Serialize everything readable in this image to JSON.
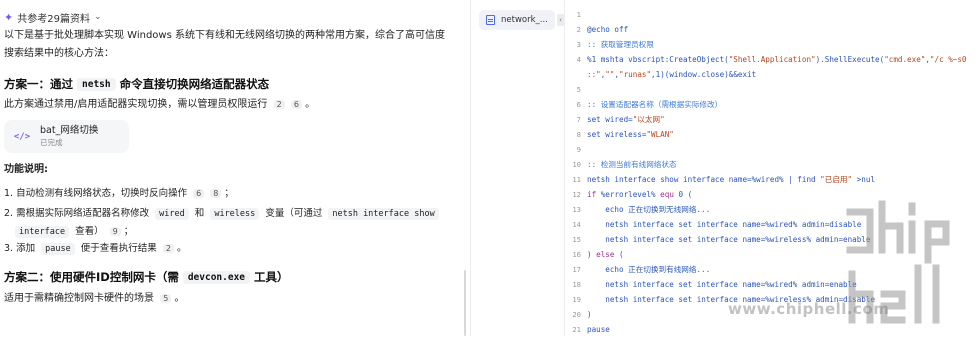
{
  "chat": {
    "sources_label": "共参考29篇资料",
    "intro_line1": "以下是基于批处理脚本实现 Windows 系统下有线和无线网络切换的两种常用方案，综合了高可信度",
    "intro_line2": "搜索结果中的核心方法：",
    "method1": {
      "title_prefix": "方案一：通过",
      "code": "netsh",
      "title_suffix": "命令直接切换网络适配器状态",
      "desc": "此方案通过禁用/启用适配器实现切换，需以管理员权限运行",
      "refs": [
        "2",
        "6"
      ]
    },
    "card": {
      "title": "bat_网络切换",
      "status": "已完成",
      "icon": "</>"
    },
    "features_title": "功能说明:",
    "features": [
      {
        "num": "1.",
        "text": "自动检测有线网络状态，切换时反向操作",
        "refs": [
          "6",
          "8"
        ],
        "end": "；"
      },
      {
        "num": "2.",
        "text_a": "需根据实际网络适配器名称修改",
        "code1": "wired",
        "text_b": "和",
        "code2": "wireless",
        "text_c": "变量（可通过",
        "code3": "netsh interface show",
        "code4": "interface",
        "text_d": "查看）",
        "refs": [
          "9"
        ],
        "end": "；"
      },
      {
        "num": "3.",
        "text_a": "添加",
        "code": "pause",
        "text_b": "便于查看执行结果",
        "refs": [
          "2"
        ],
        "end": "。"
      }
    ],
    "method2": {
      "title_prefix": "方案二：使用硬件ID控制网卡（需",
      "code": "devcon.exe",
      "title_suffix": "工具）",
      "desc": "适用于需精确控制网卡硬件的场景",
      "refs": [
        "5"
      ]
    }
  },
  "editor": {
    "tab_label": "network_...",
    "collapse_glyph": "‹",
    "lines": [
      {
        "n": "1",
        "parts": []
      },
      {
        "n": "2",
        "parts": [
          {
            "c": "c-plain",
            "t": "@echo off"
          }
        ]
      },
      {
        "n": "3",
        "parts": [
          {
            "c": "c-com",
            "t": ":: 获取管理员权限"
          }
        ]
      },
      {
        "n": "4",
        "parts": [
          {
            "c": "c-plain",
            "t": "%1 mshta vbscript:CreateObject("
          },
          {
            "c": "c-str",
            "t": "\"Shell.Application\""
          },
          {
            "c": "c-plain",
            "t": ").ShellExecute("
          },
          {
            "c": "c-str",
            "t": "\"cmd.exe\""
          },
          {
            "c": "c-plain",
            "t": ","
          },
          {
            "c": "c-str",
            "t": "\"/c %~s0"
          }
        ]
      },
      {
        "n": "",
        "parts": [
          {
            "c": "c-str",
            "t": "::\""
          },
          {
            "c": "c-plain",
            "t": ","
          },
          {
            "c": "c-str",
            "t": "\"\""
          },
          {
            "c": "c-plain",
            "t": ","
          },
          {
            "c": "c-str",
            "t": "\"runas\""
          },
          {
            "c": "c-plain",
            "t": ",1)(window.close)&&exit"
          }
        ]
      },
      {
        "n": "5",
        "parts": []
      },
      {
        "n": "6",
        "parts": [
          {
            "c": "c-com",
            "t": ":: 设置适配器名称（需根据实际修改）"
          }
        ]
      },
      {
        "n": "7",
        "parts": [
          {
            "c": "c-plain",
            "t": "set wired="
          },
          {
            "c": "c-str",
            "t": "\"以太网\""
          }
        ]
      },
      {
        "n": "8",
        "parts": [
          {
            "c": "c-plain",
            "t": "set wireless="
          },
          {
            "c": "c-str",
            "t": "\"WLAN\""
          }
        ]
      },
      {
        "n": "9",
        "parts": []
      },
      {
        "n": "10",
        "parts": [
          {
            "c": "c-com",
            "t": ":: 检测当前有线网络状态"
          }
        ]
      },
      {
        "n": "11",
        "parts": [
          {
            "c": "c-plain",
            "t": "netsh interface show interface name=%wired% | find "
          },
          {
            "c": "c-str",
            "t": "\"已启用\""
          },
          {
            "c": "c-plain",
            "t": " >nul"
          }
        ]
      },
      {
        "n": "12",
        "parts": [
          {
            "c": "c-kw",
            "t": "if"
          },
          {
            "c": "c-plain",
            "t": " %errorlevel% "
          },
          {
            "c": "c-kw",
            "t": "equ"
          },
          {
            "c": "c-plain",
            "t": " 0 ("
          }
        ]
      },
      {
        "n": "13",
        "parts": [
          {
            "c": "c-plain",
            "t": "    echo 正在切换到无线网络..."
          }
        ]
      },
      {
        "n": "14",
        "parts": [
          {
            "c": "c-plain",
            "t": "    netsh interface set interface name=%wired% admin=disable"
          }
        ]
      },
      {
        "n": "15",
        "parts": [
          {
            "c": "c-plain",
            "t": "    netsh interface set interface name=%wireless% admin=enable"
          }
        ]
      },
      {
        "n": "16",
        "parts": [
          {
            "c": "c-plain",
            "t": ") "
          },
          {
            "c": "c-kw",
            "t": "else"
          },
          {
            "c": "c-plain",
            "t": " ("
          }
        ]
      },
      {
        "n": "17",
        "parts": [
          {
            "c": "c-plain",
            "t": "    echo 正在切换到有线网络..."
          }
        ]
      },
      {
        "n": "18",
        "parts": [
          {
            "c": "c-plain",
            "t": "    netsh interface set interface name=%wired% admin=enable"
          }
        ]
      },
      {
        "n": "19",
        "parts": [
          {
            "c": "c-plain",
            "t": "    netsh interface set interface name=%wireless% admin=disable"
          }
        ]
      },
      {
        "n": "20",
        "parts": [
          {
            "c": "c-plain",
            "t": ")"
          }
        ]
      },
      {
        "n": "21",
        "parts": [
          {
            "c": "c-plain",
            "t": "pause"
          }
        ]
      }
    ]
  },
  "watermark": {
    "text": "www.chiphell.com",
    "logo_word": "chip hell"
  }
}
